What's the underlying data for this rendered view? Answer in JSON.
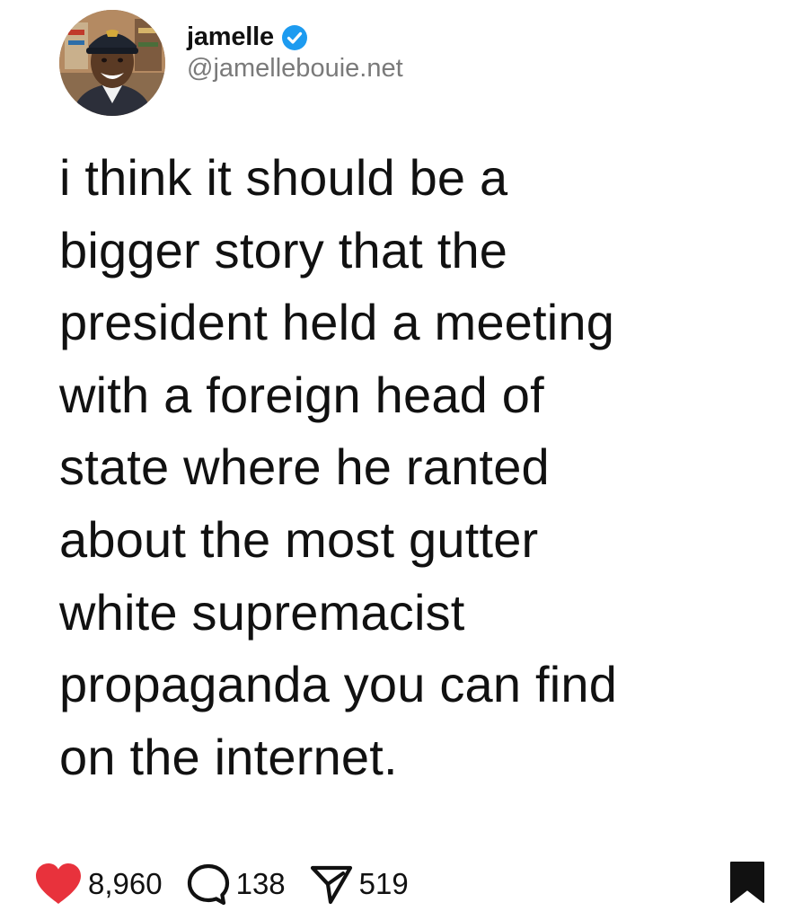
{
  "post": {
    "author": {
      "display_name": "jamelle",
      "handle": "@jamellebouie.net",
      "verified": true,
      "avatar": "profile-photo"
    },
    "text": "i think it should be a\nbigger story that the\npresident held a meeting\nwith a foreign head of\nstate where he ranted\nabout the most gutter\nwhite supremacist\npropaganda you can find\non the internet.",
    "actions": {
      "likes": "8,960",
      "replies": "138",
      "reposts": "519"
    },
    "icons": {
      "like": "heart-icon",
      "reply": "reply-bubble-icon",
      "repost": "send-icon",
      "save": "bookmark-icon",
      "verified": "verified-badge-icon"
    },
    "colors": {
      "like": "#e8323c",
      "verified": "#1d9bf0",
      "handle": "#7a7a7a",
      "text": "#111111"
    }
  }
}
